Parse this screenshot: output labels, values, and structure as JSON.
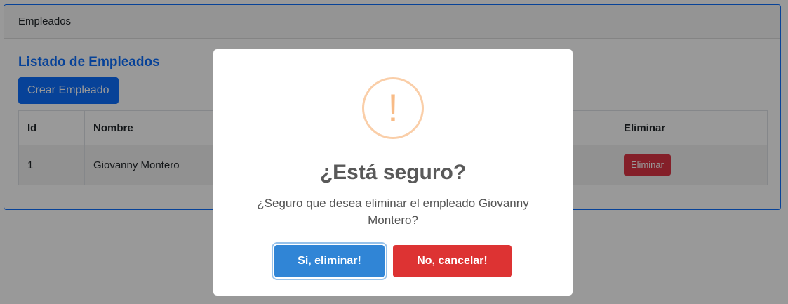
{
  "card": {
    "header": "Empleados",
    "title": "Listado de Empleados",
    "create_button": "Crear Empleado"
  },
  "table": {
    "headers": [
      "Id",
      "Nombre",
      "Eliminar"
    ],
    "rows": [
      {
        "id": "1",
        "nombre": "Giovanny Montero",
        "action": "Eliminar"
      }
    ]
  },
  "dialog": {
    "icon": "warning-icon",
    "icon_glyph": "!",
    "title": "¿Está seguro?",
    "text": "¿Seguro que desea eliminar el empleado Giovanny Montero?",
    "confirm_label": "Si, eliminar!",
    "cancel_label": "No, cancelar!"
  },
  "colors": {
    "primary": "#0d6efd",
    "danger": "#dc3545",
    "confirm": "#3085d6",
    "cancel": "#dd3333",
    "warning": "#f8bb86"
  }
}
